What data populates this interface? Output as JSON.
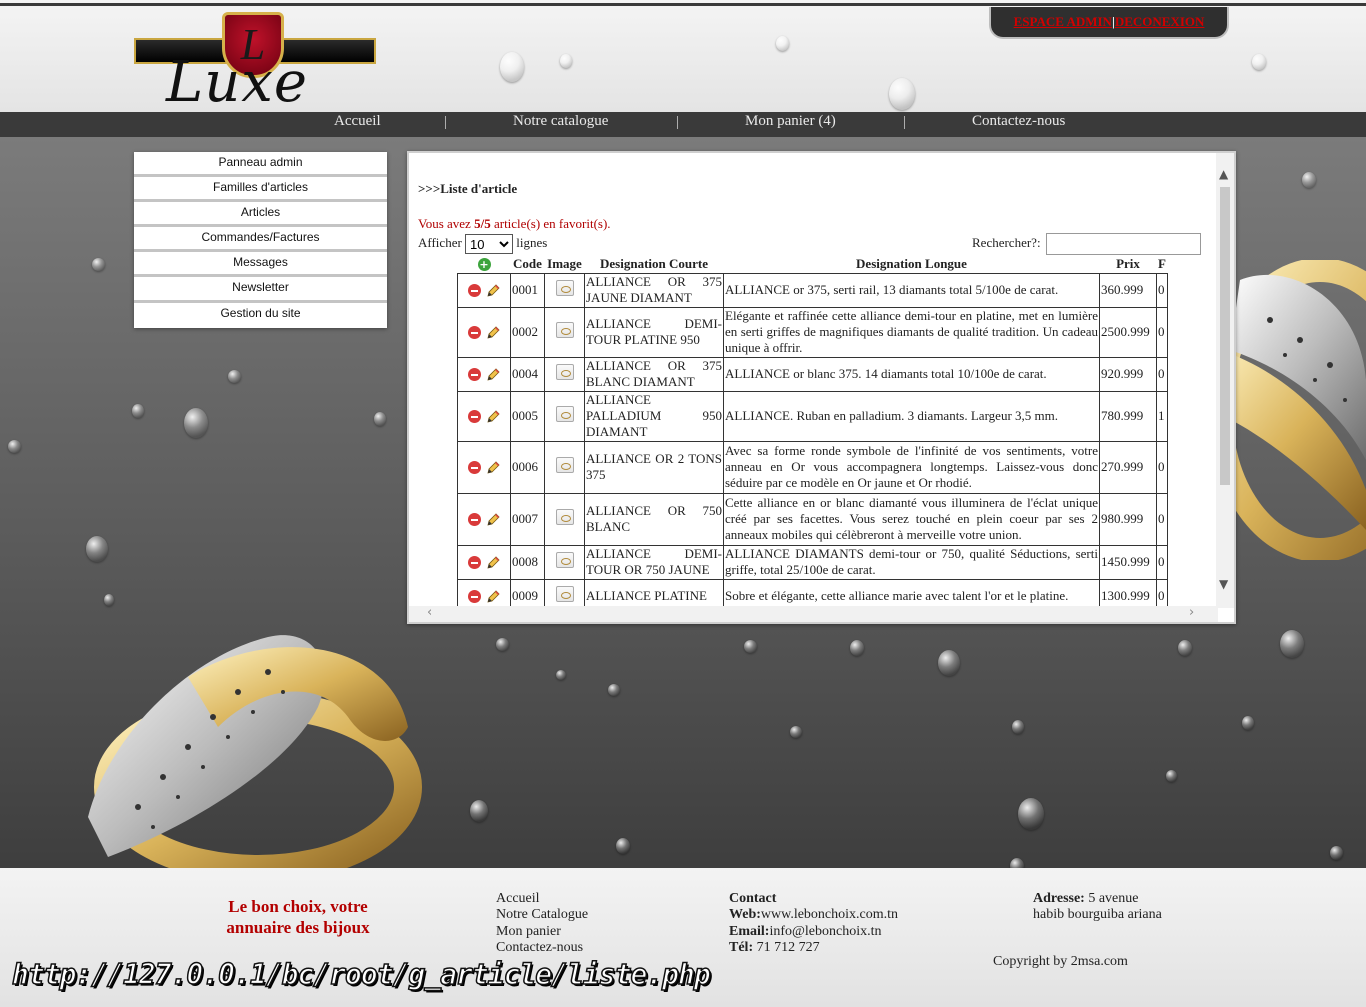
{
  "colors": {
    "accent_red": "#b30000",
    "nav_bg": "#3a3a3a",
    "admin_link": "#d10000"
  },
  "logo": {
    "letter": "L",
    "word": "Luxe"
  },
  "admin": {
    "espace_admin": "ESPACE ADMIN",
    "separator": "|",
    "deconnexion": "DECONEXION"
  },
  "nav": {
    "items": [
      "Accueil",
      "Notre catalogue",
      "Mon panier (4)",
      "Contactez-nous"
    ],
    "separator": "|"
  },
  "sidebar": {
    "items": [
      "Panneau admin",
      "Familles d'articles",
      "Articles",
      "Commandes/Factures",
      "Messages",
      "Newsletter",
      "Gestion du site"
    ]
  },
  "panel": {
    "title": ">>>Liste d'article",
    "fav_prefix": "Vous avez ",
    "fav_count": "5/5",
    "fav_suffix": " article(s) en favorit(s).",
    "show_label": "Afficher",
    "show_value": "10",
    "show_suffix": "lignes",
    "search_label": "Rechercher?:",
    "search_value": ""
  },
  "table": {
    "headers": [
      "Code",
      "Image",
      "Designation Courte",
      "Designation Longue",
      "Prix",
      "F"
    ],
    "rows": [
      {
        "code": "0001",
        "short": "ALLIANCE OR 375 JAUNE DIAMANT",
        "long": "ALLIANCE or 375, serti rail, 13 diamants total 5/100e de carat.",
        "price": "360.999",
        "f": "0"
      },
      {
        "code": "0002",
        "short": "ALLIANCE DEMI-TOUR PLATINE 950",
        "long": "Elégante et raffinée cette alliance demi-tour en platine, met en lumière en serti griffes de magnifiques diamants de qualité tradition. Un cadeau unique à offrir.",
        "price": "2500.999",
        "f": "0"
      },
      {
        "code": "0004",
        "short": "ALLIANCE OR 375 BLANC DIAMANT",
        "long": "ALLIANCE or blanc 375. 14 diamants total 10/100e de carat.",
        "price": "920.999",
        "f": "0"
      },
      {
        "code": "0005",
        "short": "ALLIANCE PALLADIUM 950 DIAMANT",
        "long": "ALLIANCE. Ruban en palladium. 3 diamants. Largeur 3,5 mm.",
        "price": "780.999",
        "f": "1"
      },
      {
        "code": "0006",
        "short": "ALLIANCE OR 2 TONS 375",
        "long": "Avec sa forme ronde symbole de l'infinité de vos sentiments, votre anneau en Or vous accompagnera longtemps. Laissez-vous donc séduire par ce modèle en Or jaune et Or rhodié.",
        "price": "270.999",
        "f": "0"
      },
      {
        "code": "0007",
        "short": "ALLIANCE OR 750 BLANC",
        "long": "Cette alliance en or blanc diamanté vous illuminera de l'éclat unique créé par ses facettes. Vous serez touché en plein coeur par ses 2 anneaux mobiles qui célèbreront à merveille votre union.",
        "price": "980.999",
        "f": "0"
      },
      {
        "code": "0008",
        "short": "ALLIANCE DEMI-TOUR OR 750 JAUNE",
        "long": "ALLIANCE DIAMANTS demi-tour or 750, qualité Séductions, serti griffe, total 25/100e de carat.",
        "price": "1450.999",
        "f": "0"
      },
      {
        "code": "0009",
        "short": "ALLIANCE PLATINE",
        "long": "Sobre et élégante, cette alliance marie avec talent l'or et le platine.",
        "price": "1300.999",
        "f": "0"
      }
    ]
  },
  "footer": {
    "slogan": "Le bon choix, votre annuaire des bijoux",
    "links": [
      "Accueil",
      "Notre Catalogue",
      "Mon panier",
      "Contactez-nous"
    ],
    "contact_title": "Contact",
    "web_label": "Web:",
    "web_value": "www.lebonchoix.com.tn",
    "email_label": "Email:",
    "email_value": "info@lebonchoix.tn",
    "tel_label": "Tél:",
    "tel_value": " 71 712 727",
    "address_label": "Adresse:",
    "address_value": " 5 avenue habib bourguiba ariana",
    "copyright": "Copyright by 2msa.com"
  },
  "url_overlay": "http://127.0.0.1/bc/root/g_article/liste.php"
}
